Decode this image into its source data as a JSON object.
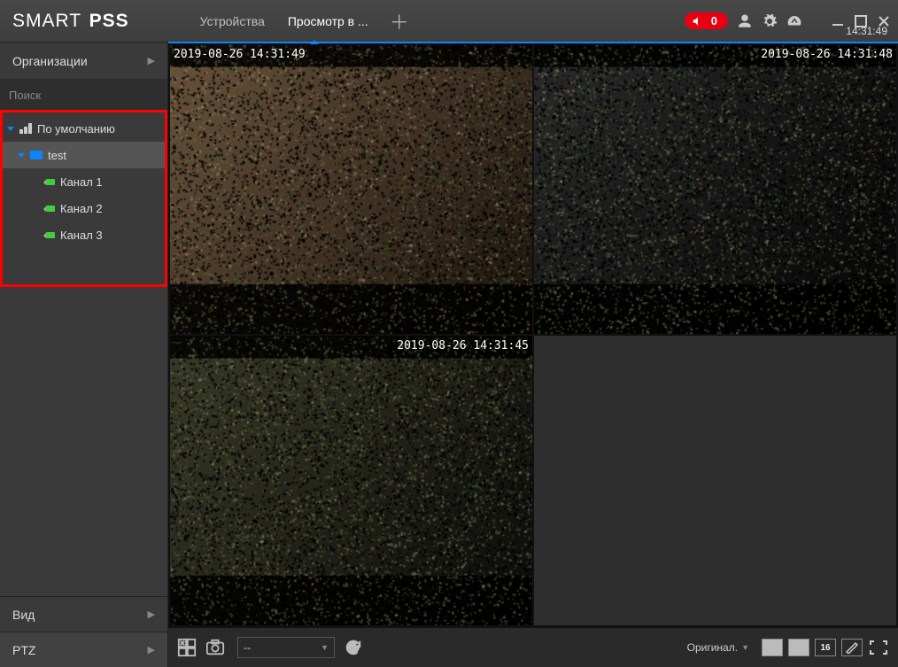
{
  "app": {
    "logo_a": "SMART ",
    "logo_b": "PSS"
  },
  "header": {
    "tabs": [
      {
        "label": "Устройства"
      },
      {
        "label": "Просмотр в ..."
      }
    ],
    "alarm_count": "0",
    "clock": "14:31:49"
  },
  "sidebar": {
    "org_title": "Организации",
    "search_placeholder": "Поиск",
    "tree": {
      "root_label": "По умолчанию",
      "device_label": "test",
      "channels": [
        {
          "label": "Канал 1"
        },
        {
          "label": "Канал 2"
        },
        {
          "label": "Канал 3"
        }
      ]
    },
    "view_label": "Вид",
    "ptz_label": "PTZ"
  },
  "cells": {
    "c1_osd": "2019-08-26 14:31:49",
    "c2_osd": "2019-08-26 14:31:48",
    "c3_osd": "2019-08-26 14:31:45"
  },
  "bottombar": {
    "stream_value": "--",
    "scale_label": "Оригинал.",
    "layout16_label": "16"
  }
}
